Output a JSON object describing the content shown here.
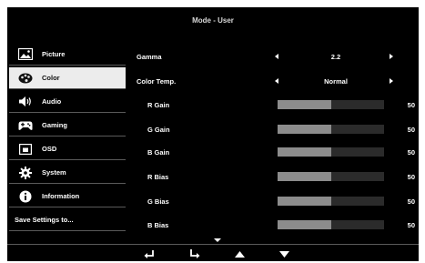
{
  "header": {
    "title": "Mode - User"
  },
  "sidebar": {
    "items": [
      {
        "label": "Picture",
        "icon": "picture-icon"
      },
      {
        "label": "Color",
        "icon": "palette-icon",
        "selected": true
      },
      {
        "label": "Audio",
        "icon": "speaker-icon"
      },
      {
        "label": "Gaming",
        "icon": "gamepad-icon"
      },
      {
        "label": "OSD",
        "icon": "osd-window-icon"
      },
      {
        "label": "System",
        "icon": "gear-icon"
      },
      {
        "label": "Information",
        "icon": "info-icon"
      }
    ],
    "save_label": "Save Settings to..."
  },
  "settings": {
    "gamma": {
      "label": "Gamma",
      "value": "2.2"
    },
    "color_temp": {
      "label": "Color Temp.",
      "value": "Normal"
    },
    "sliders": [
      {
        "label": "R Gain",
        "value": "50",
        "level": 0.5
      },
      {
        "label": "G Gain",
        "value": "50",
        "level": 0.5
      },
      {
        "label": "B Gain",
        "value": "50",
        "level": 0.5
      },
      {
        "label": "R Bias",
        "value": "50",
        "level": 0.5
      },
      {
        "label": "G Bias",
        "value": "50",
        "level": 0.5
      },
      {
        "label": "B Bias",
        "value": "50",
        "level": 0.5
      }
    ]
  },
  "footer": {
    "buttons": [
      {
        "icon": "back-icon"
      },
      {
        "icon": "enter-icon"
      },
      {
        "icon": "up-arrow-icon"
      },
      {
        "icon": "down-arrow-icon"
      }
    ]
  },
  "colors": {
    "panel": "#000000",
    "selected_bg": "#ececec",
    "bar_fill": "#8c8c8c",
    "bar_track": "#2b2b2b"
  }
}
